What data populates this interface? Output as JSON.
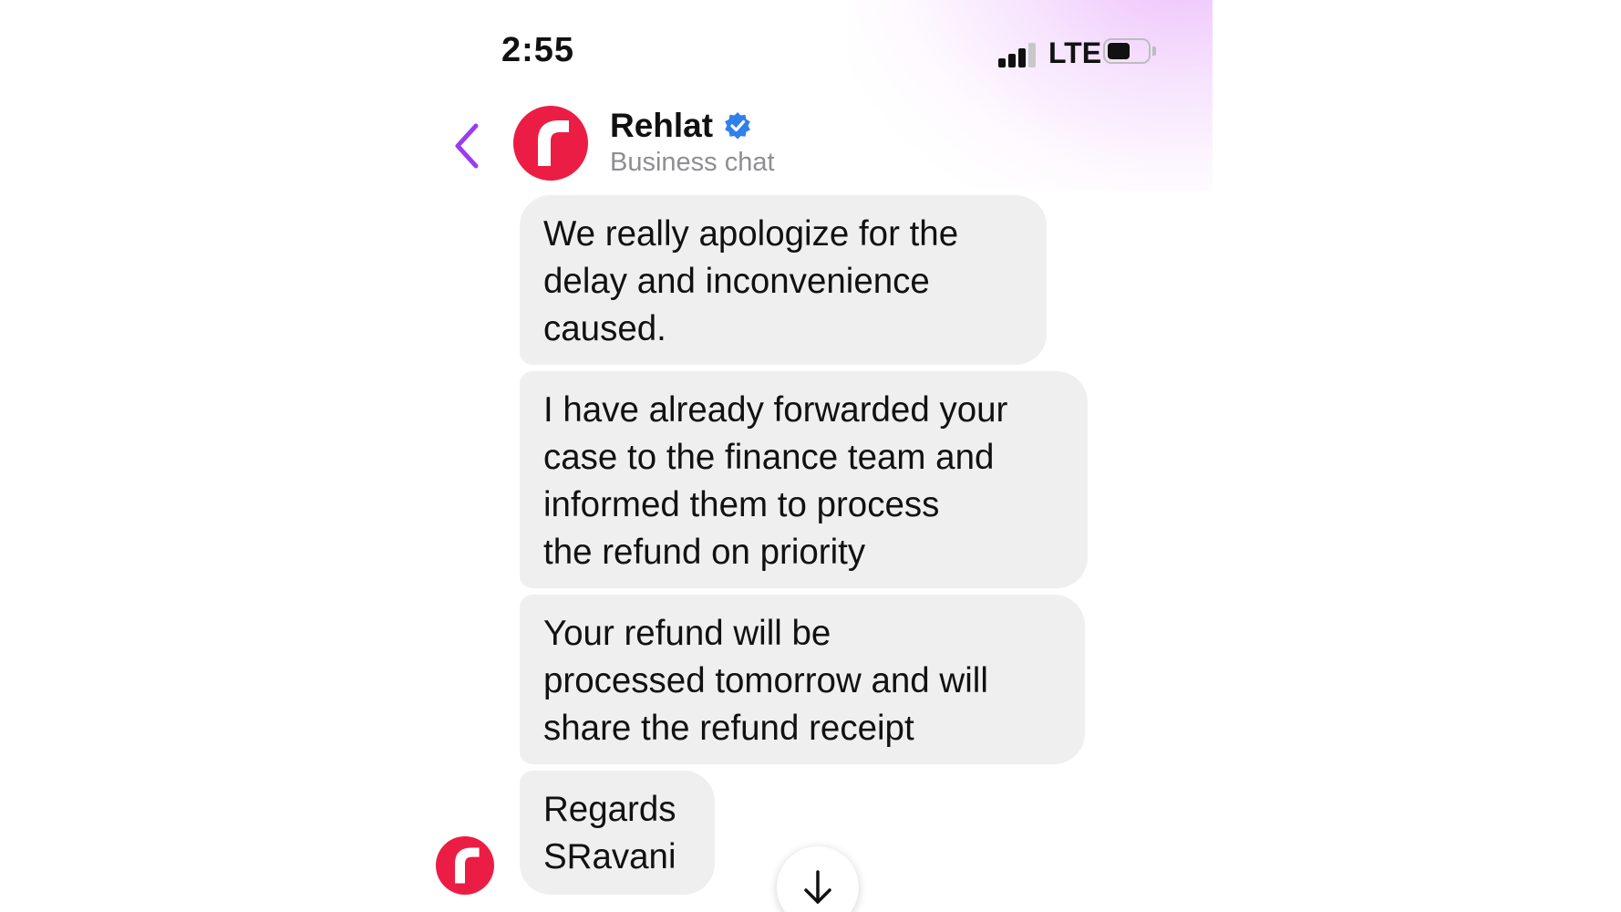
{
  "status_bar": {
    "time": "2:55",
    "network": "LTE",
    "signal_bars_active": 3,
    "signal_bars_total": 4,
    "battery_level": 0.5
  },
  "header": {
    "back_icon": "chevron-left-icon",
    "contact_name": "Rehlat",
    "verified_icon": "verified-badge-icon",
    "subtitle": "Business chat",
    "avatar_letter": "r"
  },
  "messages": [
    {
      "sender": "incoming",
      "lines": [
        "We really apologize for the",
        "delay and inconvenience",
        "caused."
      ]
    },
    {
      "sender": "incoming",
      "lines": [
        "I have already forwarded your",
        "case to the finance team and",
        "informed them to process",
        "the refund on priority"
      ]
    },
    {
      "sender": "incoming",
      "lines": [
        "Your refund will be",
        "processed tomorrow and will",
        "share the refund receipt"
      ]
    },
    {
      "sender": "incoming",
      "lines": [
        "Regards",
        "SRavani"
      ]
    }
  ],
  "scroll_button": {
    "icon": "arrow-down-icon"
  },
  "colors": {
    "brand": "#ec1d45",
    "accent_back": "#9b3cf0",
    "verified": "#2f80ed",
    "bubble_bg": "#efefef",
    "subtitle": "#8e8e93"
  }
}
